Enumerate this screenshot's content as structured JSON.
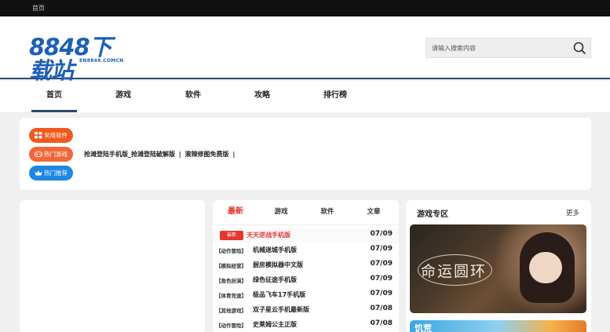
{
  "topbar": {
    "home_link": "首页"
  },
  "header": {
    "logo_main": "8848下载站",
    "logo_sub": "EN8848.COMCN",
    "search_placeholder": "请输入搜索内容"
  },
  "nav": {
    "items": [
      {
        "label": "首页",
        "active": true
      },
      {
        "label": "游戏"
      },
      {
        "label": "软件"
      },
      {
        "label": "攻略"
      },
      {
        "label": "排行榜"
      }
    ]
  },
  "quick": {
    "pills": [
      {
        "label": "常用软件",
        "icon": "grid-icon",
        "color": "#f05a1e"
      },
      {
        "label": "热门游戏",
        "icon": "gamepad-icon",
        "color": "#f0673a"
      },
      {
        "label": "热门推荐",
        "icon": "crown-icon",
        "color": "#1e87e6"
      }
    ],
    "links": [
      "抢滩登陆手机版_抢滩登陆破解版",
      "|",
      "滚辣修图免费版",
      "|"
    ]
  },
  "latest": {
    "tabs": [
      "最新",
      "游戏",
      "软件",
      "文章"
    ],
    "rows": [
      {
        "badge": "最新",
        "name": "天天逆战手机版",
        "date": "07/09",
        "hot": true
      },
      {
        "cat": "【动作冒险】",
        "name": "机械迷城手机版",
        "date": "07/09"
      },
      {
        "cat": "【模拟经营】",
        "name": "厨房模拟器中文版",
        "date": "07/09"
      },
      {
        "cat": "【角色扮演】",
        "name": "绿色征途手机版",
        "date": "07/09"
      },
      {
        "cat": "【体育竞速】",
        "name": "极品飞车17手机版",
        "date": "07/09"
      },
      {
        "cat": "【其他游戏】",
        "name": "双子星云手机最新版",
        "date": "07/08"
      },
      {
        "cat": "【动作冒险】",
        "name": "史莱姆公主正版",
        "date": "07/08"
      }
    ]
  },
  "zone": {
    "title": "游戏专区",
    "more": "更多",
    "banner_text": "命运圆环",
    "banner2_text": "饥荒"
  },
  "colors": {
    "accent_red": "#e5362e",
    "nav_underline": "#2b4a6b",
    "logo_blue": "#1d5fb8"
  }
}
